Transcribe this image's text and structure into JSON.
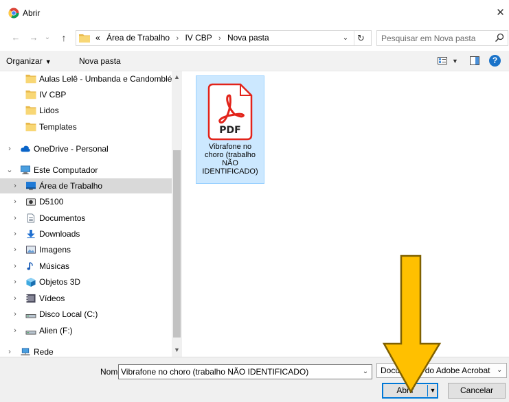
{
  "window": {
    "title": "Abrir",
    "close_glyph": "✕"
  },
  "address": {
    "crumbs": [
      "«",
      "Área de Trabalho",
      "IV CBP",
      "Nova pasta"
    ],
    "separator": "›"
  },
  "search": {
    "placeholder": "Pesquisar em Nova pasta"
  },
  "toolbar": {
    "organize_label": "Organizar",
    "new_folder_label": "Nova pasta",
    "help_label": "?"
  },
  "nav": {
    "items": [
      {
        "label": "Aulas Lelê - Umbanda e Candomblé",
        "icon": "folder-icon",
        "chevron": ""
      },
      {
        "label": "IV CBP",
        "icon": "folder-icon",
        "chevron": ""
      },
      {
        "label": "Lidos",
        "icon": "folder-icon",
        "chevron": ""
      },
      {
        "label": "Templates",
        "icon": "folder-icon",
        "chevron": ""
      },
      {
        "label": "OneDrive - Personal",
        "icon": "cloud-icon",
        "chevron": "›"
      },
      {
        "label": "Este Computador",
        "icon": "computer-icon",
        "chevron": "⌄"
      },
      {
        "label": "Área de Trabalho",
        "icon": "desktop-icon",
        "chevron": "›",
        "selected": true
      },
      {
        "label": "D5100",
        "icon": "camera-icon",
        "chevron": "›"
      },
      {
        "label": "Documentos",
        "icon": "document-icon",
        "chevron": "›"
      },
      {
        "label": "Downloads",
        "icon": "download-icon",
        "chevron": "›"
      },
      {
        "label": "Imagens",
        "icon": "image-icon",
        "chevron": "›"
      },
      {
        "label": "Músicas",
        "icon": "music-icon",
        "chevron": "›"
      },
      {
        "label": "Objetos 3D",
        "icon": "cube-icon",
        "chevron": "›"
      },
      {
        "label": "Vídeos",
        "icon": "video-icon",
        "chevron": "›"
      },
      {
        "label": "Disco Local (C:)",
        "icon": "drive-icon",
        "chevron": "›"
      },
      {
        "label": "Alien (F:)",
        "icon": "drive-icon",
        "chevron": "›"
      },
      {
        "label": "Rede",
        "icon": "network-icon",
        "chevron": "›"
      }
    ]
  },
  "content": {
    "files": [
      {
        "name": "Vibrafone no choro (trabalho NÃO IDENTIFICADO)",
        "icon": "pdf-icon",
        "icon_text": "PDF"
      }
    ]
  },
  "bottom": {
    "filename_label": "Nome:",
    "filename_value": "Vibrafone no choro (trabalho NÃO IDENTIFICADO)",
    "filetype_value": "Documento do Adobe Acrobat",
    "open_label": "Abrir",
    "cancel_label": "Cancelar"
  },
  "colors": {
    "selection_bg": "#cce8ff",
    "selection_border": "#99d1ff",
    "accent": "#0078d7",
    "pdf_red": "#e2231a",
    "folder_yellow": "#f8d775",
    "annotation_arrow": "#ffc000"
  }
}
